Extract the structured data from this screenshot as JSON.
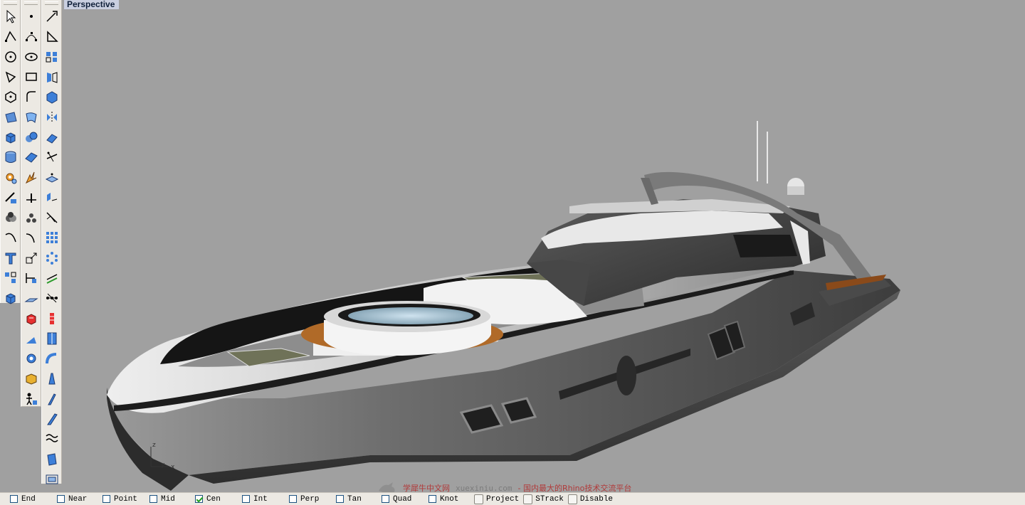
{
  "viewport": {
    "title": "Perspective",
    "axis_labels": {
      "z": "z",
      "y": "y",
      "x": "x"
    }
  },
  "toolbars": {
    "col1": [
      "select-arrow-icon",
      "polyline-icon",
      "circle-icon",
      "polygon-corner-icon",
      "polygon-center-icon",
      "surface-corners-icon",
      "box-solid-icon",
      "cylinder-icon",
      "gear-settings-icon",
      "transform-icon",
      "boolean-icon",
      "curve-icon",
      "text-icon",
      "group-icon",
      "box-solid-icon"
    ],
    "col2": [
      "point-icon",
      "curve-control-points-icon",
      "ellipse-icon",
      "rectangle-icon",
      "arc-icon",
      "loft-icon",
      "sphere-icon",
      "surface-plane-icon",
      "explode-icon",
      "split-icon",
      "point-cloud-icon",
      "fillet-curve-icon",
      "scale-icon",
      "pipe-icon",
      "cplane-icon",
      "render-icon",
      "sun-icon",
      "gear-icon",
      "material-box-icon",
      "dimension-person-icon"
    ],
    "col3": [
      "move-icon",
      "rotate-icon",
      "array-icon",
      "mirror-icon",
      "solid-box-icon",
      "mirror-surface-icon",
      "sweep-icon",
      "trim-icon",
      "move-vertex-icon",
      "extrude-icon",
      "orient-icon",
      "array-grid-icon",
      "polar-array-icon",
      "project-icon",
      "move-points-icon",
      "history-icon",
      "flip-icon",
      "bend-icon",
      "taper-icon",
      "twist-icon",
      "shear-icon",
      "flow-icon",
      "smash-icon",
      "camera-icon"
    ]
  },
  "statusbar": {
    "osnaps": [
      {
        "label": "End",
        "checked": false
      },
      {
        "label": "Near",
        "checked": false
      },
      {
        "label": "Point",
        "checked": false
      },
      {
        "label": "Mid",
        "checked": false
      },
      {
        "label": "Cen",
        "checked": true
      },
      {
        "label": "Int",
        "checked": false
      },
      {
        "label": "Perp",
        "checked": false
      },
      {
        "label": "Tan",
        "checked": false
      },
      {
        "label": "Quad",
        "checked": false
      },
      {
        "label": "Knot",
        "checked": false
      }
    ],
    "toggles": {
      "project": "Project",
      "strack": "STrack",
      "disable": "Disable"
    }
  },
  "watermark": {
    "site_name": "学犀牛中文网",
    "domain": "xuexiniu.com",
    "tagline": "- 国内最大的Rhino技术交流平台"
  },
  "colors": {
    "viewport_bg": "#a0a0a0",
    "toolbar_bg": "#ece9e3",
    "title_tab_bg": "#c9cfe0"
  }
}
